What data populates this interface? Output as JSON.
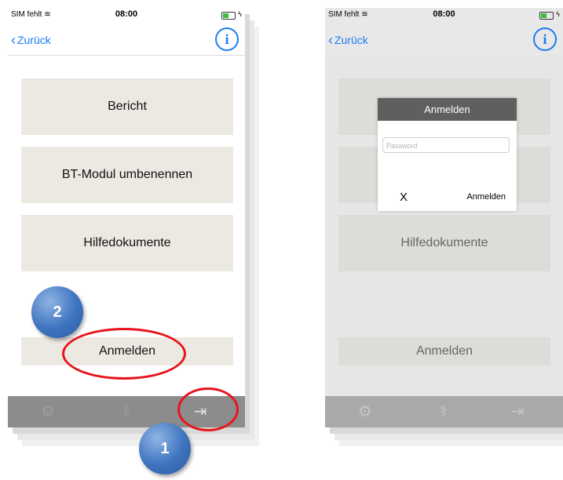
{
  "status": {
    "carrier": "SIM fehlt",
    "time": "08:00"
  },
  "nav": {
    "back_label": "Zurück"
  },
  "menu": {
    "report": "Bericht",
    "rename_bt": "BT-Modul umbenennen",
    "help_docs": "Hilfedokumente",
    "login": "Anmelden"
  },
  "dialog": {
    "title": "Anmelden",
    "password_placeholder": "Password",
    "cancel": "X",
    "confirm": "Anmelden"
  },
  "markers": {
    "step1": "1",
    "step2": "2"
  },
  "colors": {
    "accent": "#1a7cf5",
    "annotation_red": "#e8141b",
    "marker_blue": "#3e73be"
  }
}
